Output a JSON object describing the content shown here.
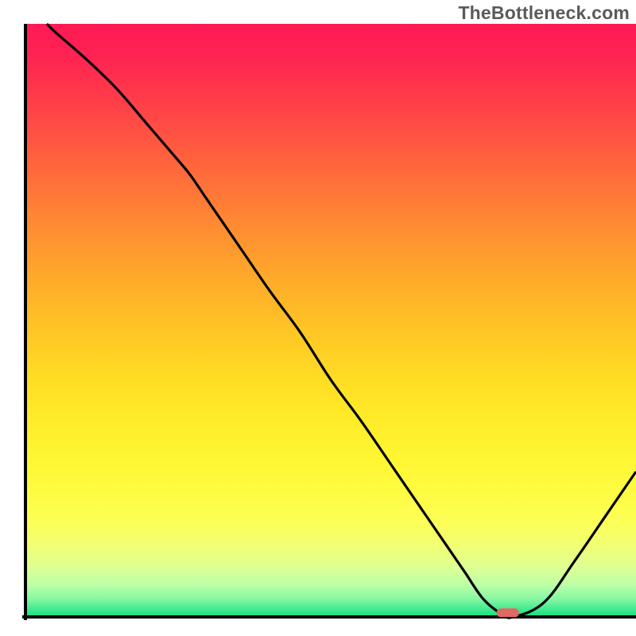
{
  "watermark": "TheBottleneck.com",
  "chart_data": {
    "type": "line",
    "title": "",
    "xlabel": "",
    "ylabel": "",
    "xlim": [
      0,
      100
    ],
    "ylim": [
      0,
      100
    ],
    "series": [
      {
        "name": "curve",
        "x": [
          3.5,
          5,
          10,
          15,
          20,
          25,
          27,
          30,
          35,
          40,
          45,
          50,
          55,
          60,
          65,
          70,
          72,
          75,
          78,
          80,
          85,
          90,
          95,
          100
        ],
        "y": [
          100,
          98.5,
          94,
          89,
          83,
          77,
          74.5,
          70,
          62.5,
          55,
          48,
          40,
          33,
          25.5,
          18,
          10.5,
          7.5,
          3,
          0.5,
          0,
          2.5,
          9.5,
          17,
          24.5
        ]
      }
    ],
    "marker": {
      "x": 79,
      "y": 0.7,
      "color": "#e06965",
      "rx": 8,
      "ry": 5
    },
    "axes_color": "#000000",
    "curve_color": "#000000",
    "gradient_stops": [
      {
        "offset": 0.0,
        "color": "#ff1a54"
      },
      {
        "offset": 0.06,
        "color": "#ff2451"
      },
      {
        "offset": 0.12,
        "color": "#ff3a4a"
      },
      {
        "offset": 0.18,
        "color": "#ff5043"
      },
      {
        "offset": 0.24,
        "color": "#ff663c"
      },
      {
        "offset": 0.3,
        "color": "#ff7c36"
      },
      {
        "offset": 0.36,
        "color": "#ff9230"
      },
      {
        "offset": 0.42,
        "color": "#ffa62b"
      },
      {
        "offset": 0.48,
        "color": "#ffba27"
      },
      {
        "offset": 0.54,
        "color": "#ffcc24"
      },
      {
        "offset": 0.6,
        "color": "#ffdd24"
      },
      {
        "offset": 0.66,
        "color": "#ffea28"
      },
      {
        "offset": 0.72,
        "color": "#fff430"
      },
      {
        "offset": 0.78,
        "color": "#fffb3e"
      },
      {
        "offset": 0.84,
        "color": "#fcff56"
      },
      {
        "offset": 0.88,
        "color": "#f1ff74"
      },
      {
        "offset": 0.915,
        "color": "#deff92"
      },
      {
        "offset": 0.945,
        "color": "#beffa6"
      },
      {
        "offset": 0.97,
        "color": "#85f7a2"
      },
      {
        "offset": 0.988,
        "color": "#3de98e"
      },
      {
        "offset": 1.0,
        "color": "#11df7f"
      }
    ]
  }
}
